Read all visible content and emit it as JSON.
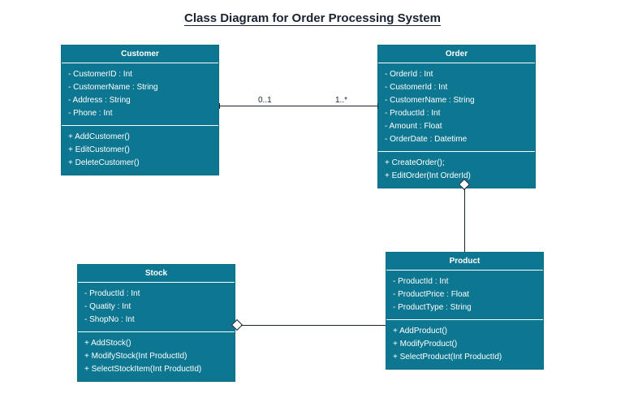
{
  "title": "Class Diagram for Order Processing System",
  "classes": {
    "customer": {
      "name": "Customer",
      "attributes": [
        "- CustomerID : Int",
        "- CustomerName : String",
        "- Address : String",
        "- Phone : Int"
      ],
      "methods": [
        "+ AddCustomer()",
        "+ EditCustomer()",
        "+ DeleteCustomer()"
      ]
    },
    "order": {
      "name": "Order",
      "attributes": [
        "- OrderId : Int",
        "- CustomerId : Int",
        "- CustomerName : String",
        "- ProductId : Int",
        "- Amount : Float",
        "- OrderDate : Datetime"
      ],
      "methods": [
        "+ CreateOrder();",
        "+ EditOrder(Int OrderId)"
      ]
    },
    "stock": {
      "name": "Stock",
      "attributes": [
        "- ProductId : Int",
        "- Quatity : Int",
        "- ShopNo : Int"
      ],
      "methods": [
        "+ AddStock()",
        "+ ModifyStock(Int ProductId)",
        "+ SelectStockItem(Int ProductId)"
      ]
    },
    "product": {
      "name": "Product",
      "attributes": [
        "- ProductId : Int",
        "- ProductPrice : Float",
        "- ProductType : String"
      ],
      "methods": [
        "+ AddProduct()",
        "+ ModifyProduct()",
        "+ SelectProduct(Int ProductId)"
      ]
    }
  },
  "multiplicity": {
    "customerSide": "0..1",
    "orderSide": "1..*"
  }
}
